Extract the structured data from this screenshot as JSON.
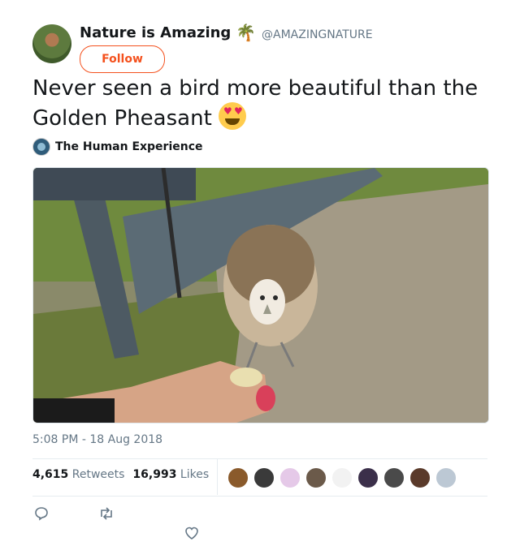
{
  "tweet": {
    "author_name": "Nature is Amazing",
    "author_emoji": "🌴",
    "handle": "@AMAZINGNATURE",
    "follow_label": "Follow",
    "text": "Never seen a bird more beautiful than the Golden Pheasant",
    "source_name": "The Human Experience",
    "timestamp": "5:08 PM - 18 Aug 2018",
    "retweets_count": "4,615",
    "retweets_label": "Retweets",
    "likes_count": "16,993",
    "likes_label": "Likes",
    "liker_avatar_colors": [
      "#8a5a2b",
      "#3a3a3a",
      "#e5c9e8",
      "#6b5a4a",
      "#f2f2f2",
      "#3b2f4a",
      "#4a4a4a",
      "#5a3a2a",
      "#bcc8d4"
    ]
  },
  "icons": {
    "reply": "reply-icon",
    "retweet": "retweet-icon",
    "like": "heart-icon"
  },
  "colors": {
    "follow_accent": "#f4511e",
    "secondary_text": "#657786"
  }
}
